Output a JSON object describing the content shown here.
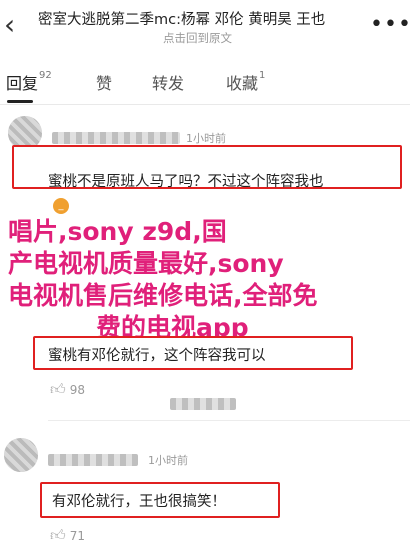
{
  "header": {
    "back_icon": "chevron-left-icon",
    "title": "密室大逃脱第二季mc:杨幂 邓伦 黄明昊 王也",
    "subtitle": "点击回到原文",
    "more_icon": "more-dots-icon"
  },
  "tabs": [
    {
      "label": "回复",
      "count": "92"
    },
    {
      "label": "赞",
      "count": ""
    },
    {
      "label": "转发",
      "count": ""
    },
    {
      "label": "收藏",
      "count": "1"
    }
  ],
  "comments": [
    {
      "time": "1小时前",
      "text": "蜜桃不是原班人马了吗？不过这个阵容我也"
    },
    {
      "time": "",
      "text": "蜜桃有邓伦就行，这个阵容我可以",
      "likes": "98"
    },
    {
      "time": "1小时前",
      "text": "有邓伦就行，王也很搞笑！",
      "likes": "71"
    }
  ],
  "overlay": {
    "line1": "唱片,sony z9d,国",
    "line2": "产电视机质量最好,sony",
    "line3": "电视机售后维修电话,全部免",
    "line4": "费的电视app"
  }
}
